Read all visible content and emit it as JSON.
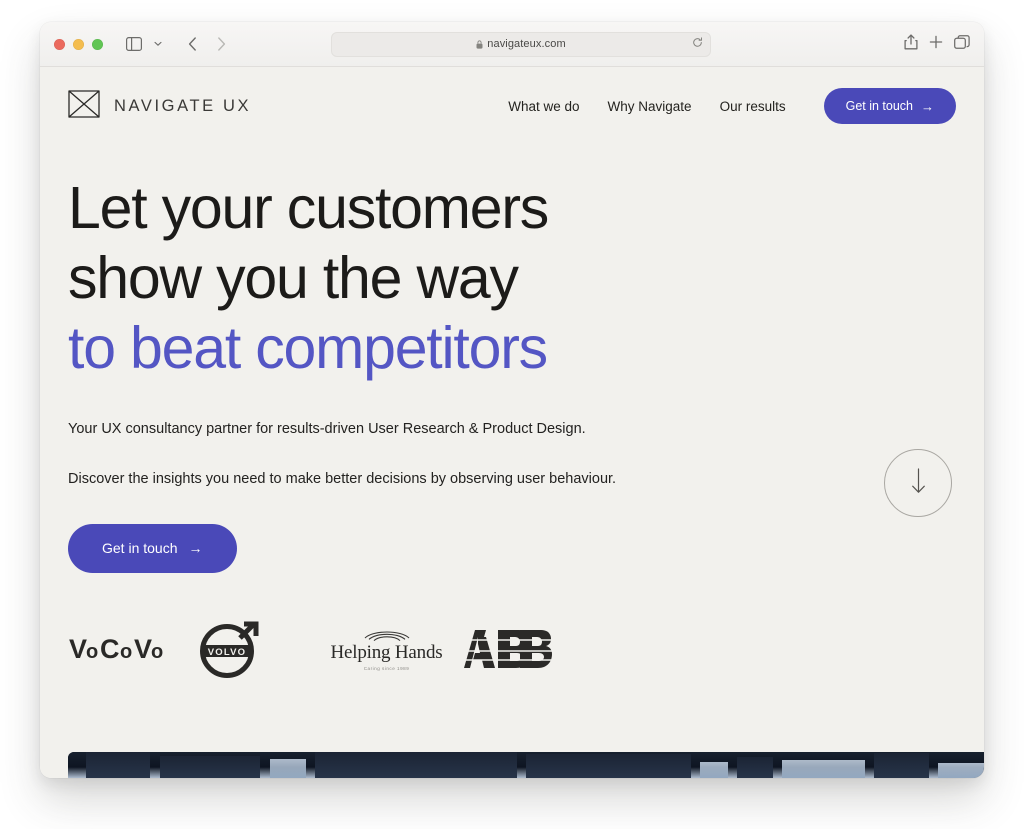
{
  "browser": {
    "traffic_lights": [
      "close",
      "minimize",
      "maximize"
    ],
    "sidebar_toggle_icon": "sidebar-icon",
    "back_icon": "chevron-left-icon",
    "forward_icon": "chevron-right-icon",
    "shield_icon": "privacy-shield-icon",
    "address": {
      "lock_icon": "lock-icon",
      "url": "navigateux.com",
      "reload_icon": "reload-icon"
    },
    "share_icon": "share-icon",
    "new_tab_icon": "plus-icon",
    "tabs_icon": "tab-overview-icon"
  },
  "site": {
    "brand": {
      "logo_icon": "bowtie-logo-icon",
      "name": "NAVIGATE UX"
    },
    "nav": [
      {
        "label": "What we do"
      },
      {
        "label": "Why Navigate"
      },
      {
        "label": "Our results"
      }
    ],
    "header_cta": {
      "label": "Get in touch",
      "arrow": "→"
    },
    "hero": {
      "headline_line1": "Let your customers",
      "headline_line2": "show you the way",
      "headline_line3": "to beat competitors",
      "paragraph1": "Your UX consultancy partner for results-driven User Research & Product Design.",
      "paragraph2": "Discover the insights you need to make better decisions by observing user behaviour.",
      "cta": {
        "label": "Get in touch",
        "arrow": "→"
      },
      "scroll_down_icon": "arrow-down-icon"
    },
    "clients": [
      {
        "name": "VoCoVo",
        "type": "wordmark"
      },
      {
        "name": "VOLVO",
        "type": "volvo-emblem"
      },
      {
        "name": "Helping Hands",
        "tagline": "Caring since 1989",
        "type": "wordmark"
      },
      {
        "name": "ABB",
        "type": "wordmark"
      }
    ]
  },
  "colors": {
    "accent": "#4a49b8",
    "headline_accent": "#5456c4",
    "page_background": "#f2f1ed",
    "text": "#1c1b19"
  }
}
